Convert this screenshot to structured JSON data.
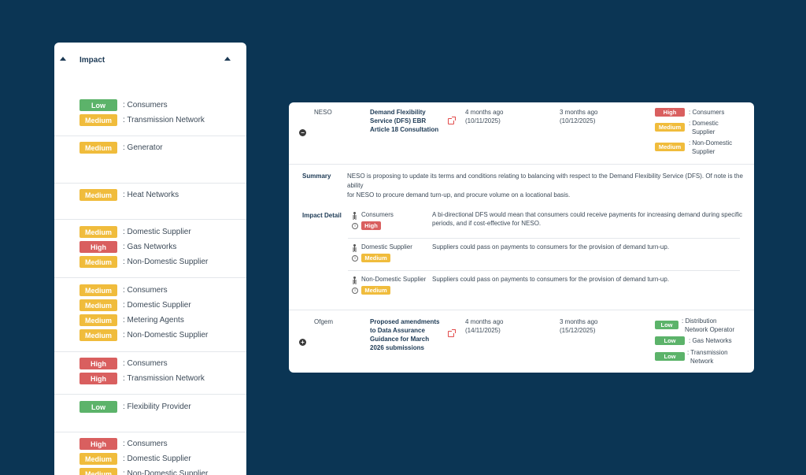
{
  "left_panel": {
    "title": "Impact",
    "groups": [
      {
        "rows": [
          {
            "level": "Low",
            "label": ": Consumers"
          },
          {
            "level": "Medium",
            "label": ": Transmission Network"
          }
        ]
      },
      {
        "rows": [
          {
            "level": "Medium",
            "label": ": Generator"
          }
        ]
      },
      {
        "rows": [
          {
            "level": "Medium",
            "label": ": Heat Networks"
          }
        ]
      },
      {
        "rows": [
          {
            "level": "Medium",
            "label": ": Domestic Supplier"
          },
          {
            "level": "High",
            "label": ": Gas Networks"
          },
          {
            "level": "Medium",
            "label": ": Non-Domestic Supplier"
          }
        ]
      },
      {
        "rows": [
          {
            "level": "Medium",
            "label": ": Consumers"
          },
          {
            "level": "Medium",
            "label": ": Domestic Supplier"
          },
          {
            "level": "Medium",
            "label": ": Metering Agents"
          },
          {
            "level": "Medium",
            "label": ": Non-Domestic Supplier"
          }
        ]
      },
      {
        "rows": [
          {
            "level": "High",
            "label": ": Consumers"
          },
          {
            "level": "High",
            "label": ": Transmission Network"
          }
        ]
      },
      {
        "rows": [
          {
            "level": "Low",
            "label": ": Flexibility Provider"
          }
        ]
      },
      {
        "rows": [
          {
            "level": "High",
            "label": ": Consumers"
          },
          {
            "level": "Medium",
            "label": ": Domestic Supplier"
          },
          {
            "level": "Medium",
            "label": ": Non-Domestic Supplier"
          }
        ]
      }
    ]
  },
  "card": {
    "entry1": {
      "org": "NESO",
      "title_lines": [
        "Demand Flexibility",
        "Service (DFS) EBR",
        "Article 18 Consultation"
      ],
      "published_rel": "4 months ago",
      "published_date": "(10/11/2025)",
      "closes_rel": "3 months ago",
      "closes_date": "(10/12/2025)",
      "impacts": [
        {
          "level": "High",
          "lines": [
            ": Consumers"
          ]
        },
        {
          "level": "Medium",
          "lines": [
            ": Domestic",
            "Supplier"
          ]
        },
        {
          "level": "Medium",
          "lines": [
            ": Non-Domestic",
            "Supplier"
          ]
        }
      ],
      "summary_label": "Summary",
      "summary_lines": [
        "NESO is proposing to update its terms and conditions relating to balancing with respect to the Demand Flexibility Service (DFS). Of note is the ability",
        "for NESO to procure demand turn-up, and procure volume on a locational basis."
      ],
      "impact_detail_label": "Impact Detail",
      "details": [
        {
          "party": "Consumers",
          "level": "High",
          "lines": [
            "A bi-directional DFS would mean that consumers could receive payments for increasing demand during specific",
            "periods, and if cost-effective for NESO."
          ]
        },
        {
          "party": "Domestic Supplier",
          "level": "Medium",
          "lines": [
            "Suppliers could pass on payments to consumers for the provision of demand turn-up."
          ]
        },
        {
          "party": "Non-Domestic Supplier",
          "level": "Medium",
          "lines": [
            "Suppliers could pass on payments to consumers for the provision of demand turn-up."
          ]
        }
      ]
    },
    "entry2": {
      "org": "Ofgem",
      "title_lines": [
        "Proposed amendments",
        "to Data Assurance",
        "Guidance for March",
        "2026 submissions"
      ],
      "published_rel": "4 months ago",
      "published_date": "(14/11/2025)",
      "closes_rel": "3 months ago",
      "closes_date": "(15/12/2025)",
      "impacts": [
        {
          "level": "Low",
          "lines": [
            ": Distribution",
            "Network Operator"
          ]
        },
        {
          "level": "Low",
          "lines": [
            ": Gas Networks"
          ]
        },
        {
          "level": "Low",
          "lines": [
            ": Transmission",
            "Network"
          ]
        }
      ]
    }
  },
  "colors": {
    "background": "#0b3554",
    "low": "#5cb36a",
    "medium": "#f0bc3c",
    "high": "#d95f5f"
  }
}
